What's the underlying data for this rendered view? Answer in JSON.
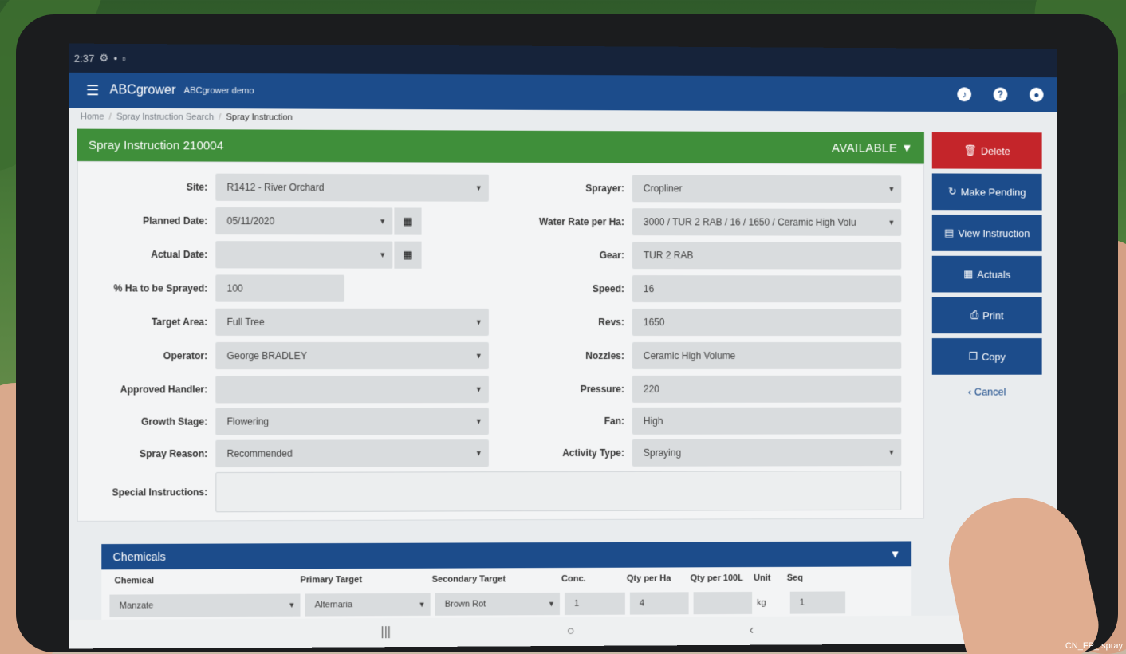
{
  "statusbar": {
    "time": "2:37"
  },
  "appbar": {
    "menu_icon": "hamburger-icon",
    "brand": "ABCgrower",
    "account": "ABCgrower demo"
  },
  "breadcrumb": {
    "items": [
      "Home",
      "Spray Instruction Search",
      "Spray Instruction"
    ]
  },
  "header": {
    "title": "Spray Instruction 210004",
    "status": "AVAILABLE"
  },
  "form_left": [
    {
      "label": "Site:",
      "value": "R1412 - River Orchard"
    },
    {
      "label": "Planned Date:",
      "value": "05/11/2020"
    },
    {
      "label": "Actual Date:",
      "value": ""
    },
    {
      "label": "% Ha to be Sprayed:",
      "value": "100"
    },
    {
      "label": "Target Area:",
      "value": "Full Tree"
    },
    {
      "label": "Operator:",
      "value": "George BRADLEY"
    },
    {
      "label": "Approved Handler:",
      "value": ""
    },
    {
      "label": "Growth Stage:",
      "value": "Flowering"
    },
    {
      "label": "Spray Reason:",
      "value": "Recommended"
    },
    {
      "label": "Special Instructions:",
      "value": ""
    }
  ],
  "form_right": [
    {
      "label": "Sprayer:",
      "value": "Cropliner"
    },
    {
      "label": "Water Rate per Ha:",
      "value": "3000 / TUR 2 RAB / 16 / 1650 / Ceramic High Volu"
    },
    {
      "label": "Gear:",
      "value": "TUR 2 RAB"
    },
    {
      "label": "Speed:",
      "value": "16"
    },
    {
      "label": "Revs:",
      "value": "1650"
    },
    {
      "label": "Nozzles:",
      "value": "Ceramic High Volume"
    },
    {
      "label": "Pressure:",
      "value": "220"
    },
    {
      "label": "Fan:",
      "value": "High"
    },
    {
      "label": "Activity Type:",
      "value": "Spraying"
    }
  ],
  "actions": {
    "delete": "Delete",
    "make_pending": "Make Pending",
    "view_instruction": "View Instruction",
    "actuals": "Actuals",
    "print": "Print",
    "copy": "Copy",
    "cancel": "Cancel"
  },
  "chemicals": {
    "title": "Chemicals",
    "headers": [
      "Chemical",
      "Primary Target",
      "Secondary Target",
      "Conc.",
      "Qty per Ha",
      "Qty per 100L",
      "Unit",
      "Seq"
    ],
    "row": [
      "Manzate",
      "Alternaria",
      "Brown Rot",
      "1",
      "4",
      "",
      "kg",
      "1"
    ]
  },
  "colors": {
    "primary": "#1c4c8b",
    "success": "#3f8f3a",
    "danger": "#c4252a"
  },
  "watermark": "CN_FP_ spray"
}
